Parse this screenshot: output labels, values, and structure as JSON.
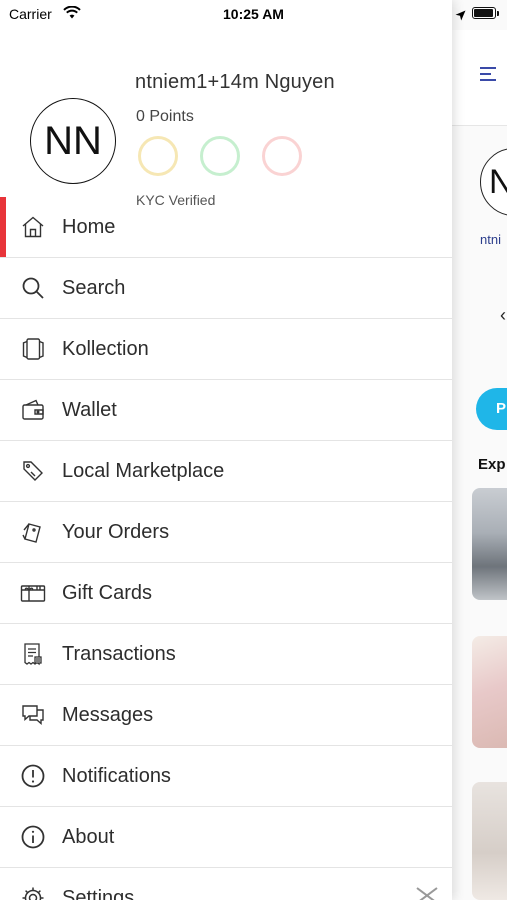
{
  "status_bar": {
    "carrier": "Carrier",
    "time": "10:25 AM"
  },
  "profile": {
    "avatar_initials": "NN",
    "name": "ntniem1+14m Nguyen",
    "points": "0 Points",
    "badge_colors": [
      "#f6e7b4",
      "#c6efcf",
      "#fad3d3"
    ],
    "kyc_status": "KYC Verified"
  },
  "menu": {
    "active_color": "#e8343a",
    "items": [
      {
        "label": "Home",
        "icon": "home-icon"
      },
      {
        "label": "Search",
        "icon": "search-icon"
      },
      {
        "label": "Kollection",
        "icon": "cards-icon"
      },
      {
        "label": "Wallet",
        "icon": "wallet-icon"
      },
      {
        "label": "Local Marketplace",
        "icon": "tag-icon"
      },
      {
        "label": "Your Orders",
        "icon": "orders-icon"
      },
      {
        "label": "Gift Cards",
        "icon": "gift-card-icon"
      },
      {
        "label": "Transactions",
        "icon": "receipt-icon"
      },
      {
        "label": "Messages",
        "icon": "chat-icon"
      },
      {
        "label": "Notifications",
        "icon": "alert-icon"
      },
      {
        "label": "About",
        "icon": "info-icon"
      },
      {
        "label": "Settings",
        "icon": "gear-icon"
      }
    ]
  },
  "background_screen": {
    "avatar_initials": "N",
    "username_fragment": "ntni",
    "pill_fragment": "P",
    "section_fragment": "Exp",
    "accent": "#1fb6e8"
  }
}
